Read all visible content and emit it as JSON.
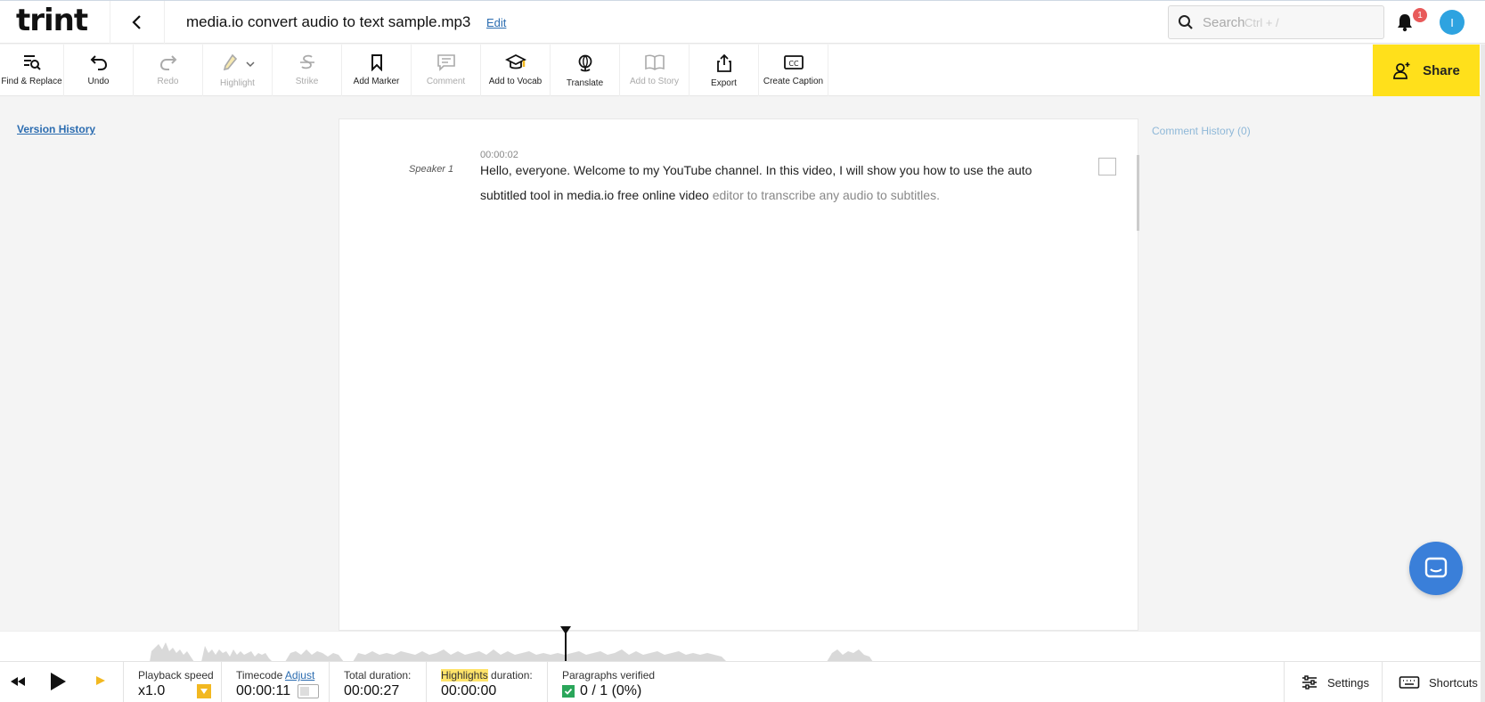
{
  "app": {
    "logo": "trint",
    "doc_title": "media.io convert audio to text sample.mp3",
    "edit_label": "Edit"
  },
  "search": {
    "placeholder": "Search",
    "hint": "Ctrl + /"
  },
  "notifications": {
    "count": "1"
  },
  "user": {
    "initial": "I"
  },
  "toolbar": {
    "find_replace": "Find & Replace",
    "undo": "Undo",
    "redo": "Redo",
    "highlight": "Highlight",
    "strike": "Strike",
    "add_marker": "Add Marker",
    "comment": "Comment",
    "add_to_vocab": "Add to Vocab",
    "translate": "Translate",
    "add_to_story": "Add to Story",
    "export": "Export",
    "create_caption": "Create Caption",
    "share": "Share"
  },
  "panels": {
    "version_history": "Version History",
    "comment_history": "Comment History (0)"
  },
  "transcript": {
    "timestamp": "00:00:02",
    "speaker": "Speaker 1",
    "played_text": "Hello, everyone. Welcome to my YouTube channel. In this video, I will show you how to use the auto subtitled tool in media.io free online video ",
    "unplayed_text": "editor to transcribe any audio to subtitles."
  },
  "bottom_bar": {
    "playback_speed_label": "Playback speed",
    "playback_speed_value": "x1.0",
    "timecode_label": "Timecode",
    "timecode_adjust": "Adjust",
    "timecode_value": "00:00:11",
    "total_duration_label": "Total duration:",
    "total_duration_value": "00:00:27",
    "highlights_label": "Highlights",
    "highlights_suffix": " duration:",
    "highlights_value": "00:00:00",
    "paragraphs_label": "Paragraphs verified",
    "paragraphs_value": "0 / 1 (0%)",
    "settings": "Settings",
    "shortcuts": "Shortcuts"
  },
  "colors": {
    "accent_yellow": "#ffe01b",
    "link_blue": "#2b6cb0",
    "avatar_blue": "#2ea3e0",
    "badge_red": "#e85a5a",
    "chat_blue": "#3a7fd9",
    "verified_green": "#2aa65a"
  }
}
